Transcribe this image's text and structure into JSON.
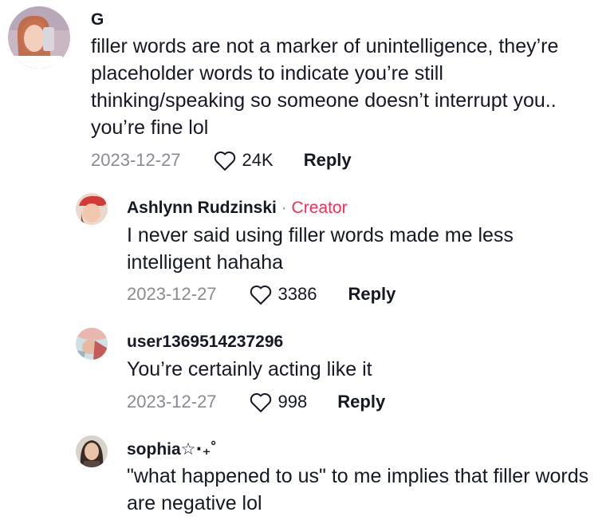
{
  "comments": [
    {
      "username": "G",
      "text": "filler words are not a marker of unintelligence, they’re placeholder words to indicate you’re still thinking/speaking so someone doesn’t interrupt you.. you’re fine lol",
      "date": "2023-12-27",
      "likes": "24K",
      "reply_label": "Reply",
      "avatar_icon": "user-avatar-icon"
    },
    {
      "username": "Ashlynn Rudzinski",
      "separator": "·",
      "badge": "Creator",
      "text": "I never said using filler words made me less intelligent hahaha",
      "date": "2023-12-27",
      "likes": "3386",
      "reply_label": "Reply",
      "avatar_icon": "creator-avatar-icon"
    },
    {
      "username": "user1369514237296",
      "text": "You’re certainly acting like it",
      "date": "2023-12-27",
      "likes": "998",
      "reply_label": "Reply",
      "avatar_icon": "user-avatar-icon"
    },
    {
      "username": "sophia☆⋅₊˚",
      "text": "\"what happened to us\" to me implies that filler words are negative lol",
      "avatar_icon": "user-avatar-icon"
    }
  ],
  "colors": {
    "text": "#161823",
    "muted": "#8a8b91",
    "creator": "#fe2c55"
  },
  "icons": {
    "like": "heart-outline-icon"
  }
}
